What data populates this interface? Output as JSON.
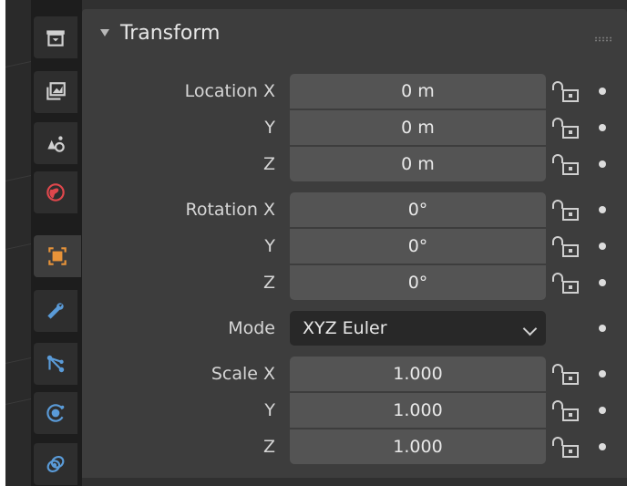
{
  "panel": {
    "title": "Transform"
  },
  "tabs": [
    {
      "name": "render-properties",
      "active": false
    },
    {
      "name": "output-properties",
      "active": false
    },
    {
      "name": "view-layer-properties",
      "active": false
    },
    {
      "name": "world-properties",
      "active": false
    },
    {
      "name": "object-properties",
      "active": true
    },
    {
      "name": "modifier-properties",
      "active": false
    },
    {
      "name": "particle-properties",
      "active": false
    },
    {
      "name": "physics-properties",
      "active": false
    },
    {
      "name": "constraint-properties",
      "active": false
    }
  ],
  "location": {
    "label_x": "Location X",
    "label_y": "Y",
    "label_z": "Z",
    "x": "0 m",
    "y": "0 m",
    "z": "0 m"
  },
  "rotation": {
    "label_x": "Rotation X",
    "label_y": "Y",
    "label_z": "Z",
    "x": "0°",
    "y": "0°",
    "z": "0°"
  },
  "mode": {
    "label": "Mode",
    "value": "XYZ Euler"
  },
  "scale": {
    "label_x": "Scale X",
    "label_y": "Y",
    "label_z": "Z",
    "x": "1.000",
    "y": "1.000",
    "z": "1.000"
  },
  "colors": {
    "background": "#303030",
    "panel": "#3d3d3d",
    "field": "#545454",
    "select": "#282828",
    "accent_orange": "#e89339",
    "tab_icon": "#c8c8c8"
  }
}
